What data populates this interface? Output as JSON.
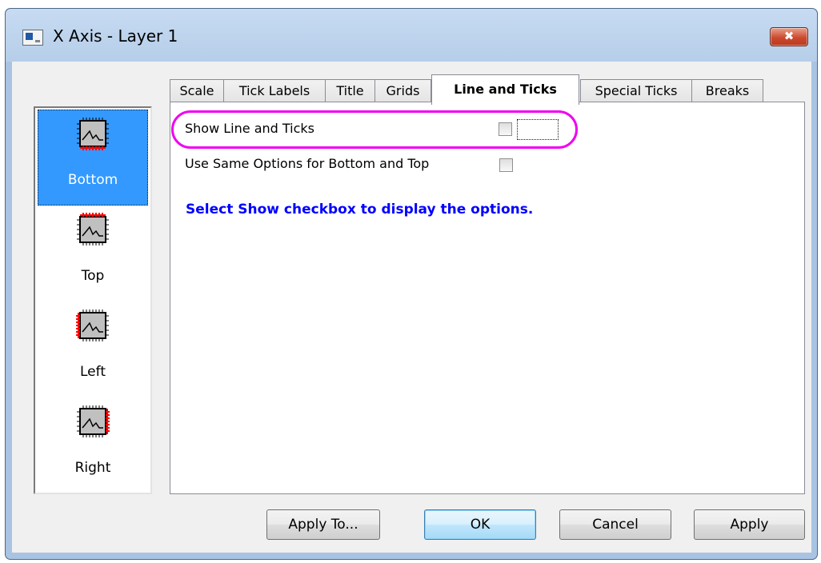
{
  "window": {
    "title": "X Axis - Layer 1",
    "close_glyph": "✖"
  },
  "axis_list": [
    {
      "label": "Bottom",
      "icon": "bottom-axis-icon",
      "selected": true
    },
    {
      "label": "Top",
      "icon": "top-axis-icon",
      "selected": false
    },
    {
      "label": "Left",
      "icon": "left-axis-icon",
      "selected": false
    },
    {
      "label": "Right",
      "icon": "right-axis-icon",
      "selected": false
    }
  ],
  "tabs": [
    {
      "label": "Scale",
      "active": false
    },
    {
      "label": "Tick Labels",
      "active": false
    },
    {
      "label": "Title",
      "active": false
    },
    {
      "label": "Grids",
      "active": false
    },
    {
      "label": "Line and Ticks",
      "active": true
    },
    {
      "label": "Special Ticks",
      "active": false
    },
    {
      "label": "Breaks",
      "active": false
    }
  ],
  "panel": {
    "show_line_label": "Show Line and Ticks",
    "show_line_checked": false,
    "same_options_label": "Use Same Options for Bottom and Top",
    "same_options_checked": false,
    "hint": "Select Show checkbox to display the options."
  },
  "buttons": {
    "apply_to": "Apply To...",
    "ok": "OK",
    "cancel": "Cancel",
    "apply": "Apply"
  },
  "colors": {
    "selection": "#3399ff",
    "hint_text": "#0000ff",
    "highlight_oval": "#f000f0",
    "axis_marker": "#ff0000"
  }
}
